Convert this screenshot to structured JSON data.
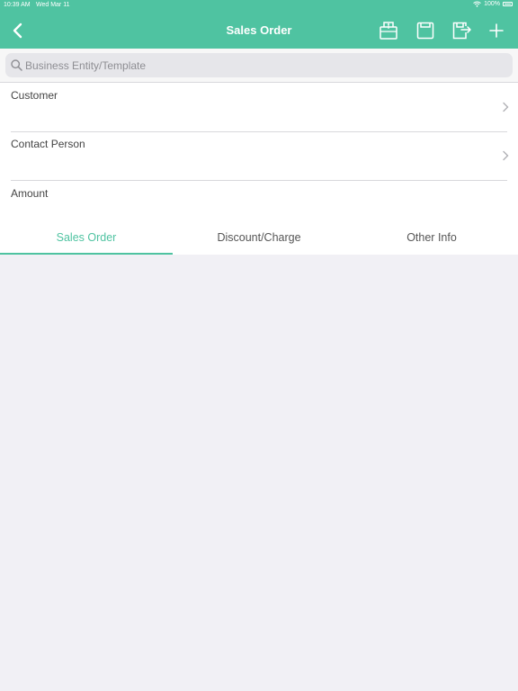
{
  "status": {
    "time": "10:39 AM",
    "date": "Wed Mar 11",
    "battery": "100%"
  },
  "navbar": {
    "title": "Sales Order",
    "accent": "#4fc3a1",
    "actions": [
      "print-icon",
      "save-icon",
      "save-as-icon",
      "add-icon"
    ]
  },
  "search": {
    "placeholder": "Business Entity/Template",
    "value": ""
  },
  "form": {
    "customer_label": "Customer",
    "contact_label": "Contact Person",
    "amount_label": "Amount"
  },
  "tabs": [
    {
      "label": "Sales Order",
      "active": true
    },
    {
      "label": "Discount/Charge",
      "active": false
    },
    {
      "label": "Other Info",
      "active": false
    }
  ]
}
